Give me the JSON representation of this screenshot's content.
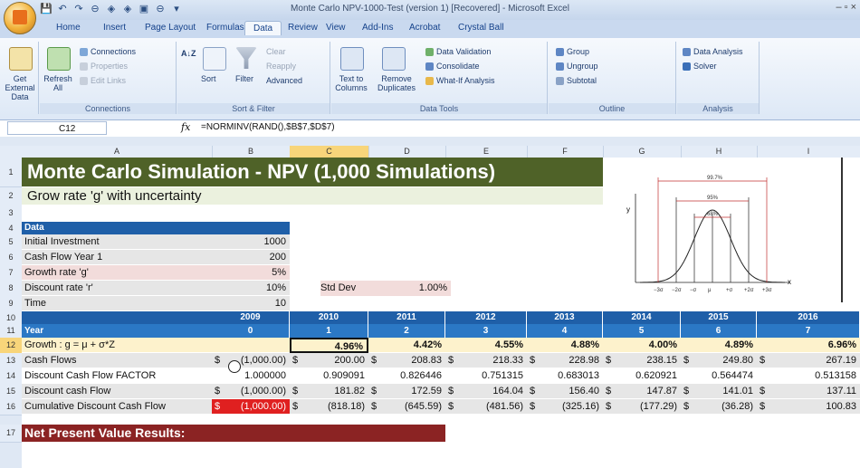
{
  "window": {
    "title": "Monte Carlo NPV-1000-Test (version 1) [Recovered] - Microsoft Excel",
    "controls": "– ▫ ×"
  },
  "qat": [
    "💾",
    "↶",
    "↷",
    "⊖",
    "◈",
    "◈",
    "▣",
    "⊖",
    "▾"
  ],
  "tabs": [
    "Home",
    "Insert",
    "Page Layout",
    "Formulas",
    "Data",
    "Review",
    "View",
    "Add-Ins",
    "Acrobat",
    "Crystal Ball"
  ],
  "active_tab": "Data",
  "ribbon": {
    "get_external": "Get External Data",
    "refresh": "Refresh All",
    "connections": "Connections",
    "properties": "Properties",
    "edit_links": "Edit Links",
    "connections_group": "Connections",
    "sort_asc": "A↓Z",
    "sort": "Sort",
    "filter": "Filter",
    "clear": "Clear",
    "reapply": "Reapply",
    "advanced": "Advanced",
    "sort_filter_group": "Sort & Filter",
    "text_to_columns": "Text to Columns",
    "remove_duplicates": "Remove Duplicates",
    "data_validation": "Data Validation",
    "consolidate": "Consolidate",
    "what_if": "What-If Analysis",
    "data_tools_group": "Data Tools",
    "group": "Group",
    "ungroup": "Ungroup",
    "subtotal": "Subtotal",
    "outline_group": "Outline",
    "data_analysis": "Data Analysis",
    "solver": "Solver",
    "analysis_group": "Analysis"
  },
  "formula_bar": {
    "name_box": "C12",
    "fx": "fx",
    "formula": "=NORMINV(RAND(),$B$7,$D$7)"
  },
  "columns": [
    "A",
    "B",
    "C",
    "D",
    "E",
    "F",
    "G",
    "H",
    "I"
  ],
  "rows": [
    "1",
    "2",
    "3",
    "4",
    "5",
    "6",
    "7",
    "8",
    "9",
    "10",
    "11",
    "12",
    "13",
    "14",
    "15",
    "16",
    "17"
  ],
  "sheet": {
    "title": "Monte Carlo Simulation  - NPV (1,000 Simulations)",
    "subtitle": "Grow rate 'g' with uncertainty",
    "data_header": "Data",
    "inputs": [
      {
        "label": "Initial Investment",
        "value": "1000"
      },
      {
        "label": "Cash Flow Year 1",
        "value": "200"
      },
      {
        "label": "Growth rate 'g'",
        "value": "5%"
      },
      {
        "label": "Discount rate  'r'",
        "value": "10%"
      },
      {
        "label": "Time",
        "value": "10"
      }
    ],
    "std_dev_label": "Std Dev",
    "std_dev_value": "1.00%",
    "years": [
      "2009",
      "2010",
      "2011",
      "2012",
      "2013",
      "2014",
      "2015",
      "2016"
    ],
    "year_label": "Year",
    "periods": [
      "0",
      "1",
      "2",
      "3",
      "4",
      "5",
      "6",
      "7"
    ],
    "growth_label": "Growth : g = μ + σ*Z",
    "growth": [
      "",
      "4.96%",
      "4.42%",
      "4.55%",
      "4.88%",
      "4.00%",
      "4.89%",
      "6.96%"
    ],
    "cash_flows_label": "Cash Flows",
    "cash_flows": [
      "(1,000.00)",
      "200.00",
      "208.83",
      "218.33",
      "228.98",
      "238.15",
      "249.80",
      "267.19"
    ],
    "factor_label": "Discount Cash Flow FACTOR",
    "factors": [
      "1.000000",
      "0.909091",
      "0.826446",
      "0.751315",
      "0.683013",
      "0.620921",
      "0.564474",
      "0.513158"
    ],
    "dcf_label": "Discount cash Flow",
    "dcf": [
      "(1,000.00)",
      "181.82",
      "172.59",
      "164.04",
      "156.40",
      "147.87",
      "141.01",
      "137.11"
    ],
    "cum_label": "Cumulative Discount Cash Flow",
    "cum": [
      "(1,000.00)",
      "(818.18)",
      "(645.59)",
      "(481.56)",
      "(325.16)",
      "(177.29)",
      "(36.28)",
      "100.83"
    ],
    "currency": "$",
    "npv_results": "Net Present Value Results:"
  },
  "bell_curve": {
    "y_axis": "y",
    "x_axis": "x",
    "ranges": [
      "99.7%",
      "95%",
      "68%"
    ],
    "ticks": [
      "−3σ",
      "−2σ",
      "−σ",
      "μ",
      "+σ",
      "+2σ",
      "+3σ"
    ]
  }
}
